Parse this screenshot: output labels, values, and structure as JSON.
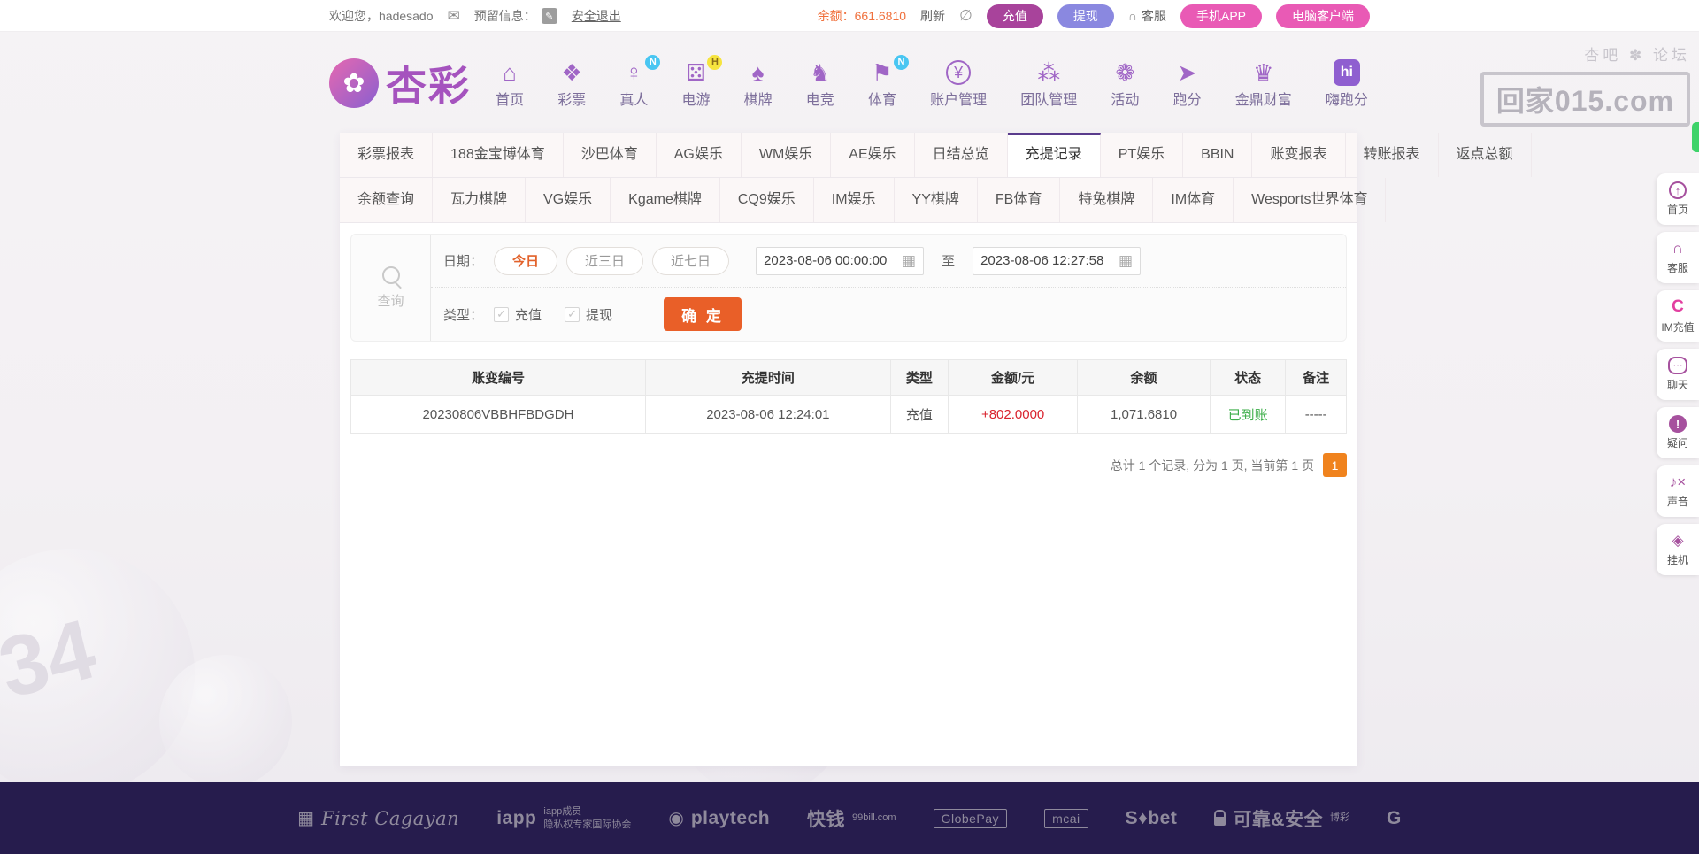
{
  "colors": {
    "accent_orange": "#e8612c",
    "balance_orange": "#f0703c",
    "recharge_purple": "#a8439b",
    "withdraw_indigo": "#8a88e0",
    "pink_button": "#e95ab5",
    "active_tab_border": "#5a3b8c",
    "amount_red": "#d9232e",
    "status_green": "#3dae4a",
    "pagination_orange": "#f0831e",
    "footer_bg": "#261c4d"
  },
  "topbar": {
    "welcome": "欢迎您，hadesado",
    "reserved_label": "预留信息：",
    "logout": "安全退出",
    "balance_label": "余额：",
    "balance_value": "661.6810",
    "refresh": "刷新",
    "recharge": "充值",
    "withdraw": "提现",
    "service": "客服",
    "mobile_app": "手机APP",
    "pc_client": "电脑客户端"
  },
  "header": {
    "logo_text": "杏彩",
    "nav": [
      {
        "label": "首页",
        "glyph": "⌂"
      },
      {
        "label": "彩票",
        "glyph": "❖"
      },
      {
        "label": "真人",
        "glyph": "♀",
        "badge": "N",
        "badge_class": "badge-cyan"
      },
      {
        "label": "电游",
        "glyph": "⚄",
        "badge": "H",
        "badge_class": "badge-yellow"
      },
      {
        "label": "棋牌",
        "glyph": "♠"
      },
      {
        "label": "电竞",
        "glyph": "♞"
      },
      {
        "label": "体育",
        "glyph": "⚑",
        "badge": "N",
        "badge_class": "badge-cyan"
      },
      {
        "label": "账户管理",
        "glyph": "¥",
        "icon_class": "circled"
      },
      {
        "label": "团队管理",
        "glyph": "⁂"
      },
      {
        "label": "活动",
        "glyph": "❁"
      },
      {
        "label": "跑分",
        "glyph": "➤"
      },
      {
        "label": "金鼎财富",
        "glyph": "♛"
      },
      {
        "label": "嗨跑分",
        "glyph": "hi",
        "icon_class": "hi-logo"
      }
    ]
  },
  "watermark": {
    "title": "杏吧 ✽ 论坛",
    "domain": "回家015.com"
  },
  "tabs": {
    "row1": [
      {
        "label": "彩票报表"
      },
      {
        "label": "188金宝博体育"
      },
      {
        "label": "沙巴体育"
      },
      {
        "label": "AG娱乐"
      },
      {
        "label": "WM娱乐"
      },
      {
        "label": "AE娱乐"
      },
      {
        "label": "日结总览"
      },
      {
        "label": "充提记录",
        "active": true
      },
      {
        "label": "PT娱乐"
      },
      {
        "label": "BBIN"
      },
      {
        "label": "账变报表"
      },
      {
        "label": "转账报表"
      },
      {
        "label": "返点总额"
      }
    ],
    "row2": [
      {
        "label": "余额查询"
      },
      {
        "label": "瓦力棋牌"
      },
      {
        "label": "VG娱乐"
      },
      {
        "label": "Kgame棋牌"
      },
      {
        "label": "CQ9娱乐"
      },
      {
        "label": "IM娱乐"
      },
      {
        "label": "YY棋牌"
      },
      {
        "label": "FB体育"
      },
      {
        "label": "特兔棋牌"
      },
      {
        "label": "IM体育"
      },
      {
        "label": "Wesports世界体育"
      }
    ]
  },
  "filter": {
    "query_label": "查询",
    "date_label": "日期：",
    "quick_buttons": [
      {
        "label": "今日",
        "active": true
      },
      {
        "label": "近三日"
      },
      {
        "label": "近七日"
      }
    ],
    "date_from": "2023-08-06 00:00:00",
    "to_label": "至",
    "date_to": "2023-08-06 12:27:58",
    "type_label": "类型：",
    "type_options": [
      {
        "label": "充值",
        "check": "✓"
      },
      {
        "label": "提现",
        "check": "✓"
      }
    ],
    "submit_label": "确 定"
  },
  "table": {
    "headers": [
      "账变编号",
      "充提时间",
      "类型",
      "金额/元",
      "余额",
      "状态",
      "备注"
    ],
    "rows": [
      {
        "id": "20230806VBBHFBDGDH",
        "time": "2023-08-06 12:24:01",
        "type": "充值",
        "amount": "+802.0000",
        "balance": "1,071.6810",
        "status": "已到账",
        "note": "-----"
      }
    ]
  },
  "pagination": {
    "summary": "总计 1 个记录, 分为 1 页, 当前第 1 页",
    "page": "1"
  },
  "sidebar": {
    "items": [
      {
        "label": "首页",
        "glyph": "↑",
        "icon_class": "circled",
        "icon_name": "back-top-icon"
      },
      {
        "label": "客服",
        "glyph": "∩",
        "icon_name": "service-headset-icon"
      },
      {
        "label": "IM充值",
        "glyph": "C",
        "icon_class": "pink-bold",
        "icon_name": "im-recharge-icon"
      },
      {
        "label": "聊天",
        "glyph": "⋯",
        "icon_class": "bubble",
        "icon_name": "chat-bubble-icon"
      },
      {
        "label": "疑问",
        "glyph": "!",
        "icon_class": "filled-circle",
        "icon_name": "question-icon"
      },
      {
        "label": "声音",
        "glyph": "♪×",
        "icon_name": "sound-mute-icon"
      },
      {
        "label": "挂机",
        "glyph": "◈",
        "icon_name": "idle-gem-icon"
      }
    ]
  },
  "footer": {
    "logos": [
      {
        "icon": "▦",
        "main": "First Cagayan",
        "sub": "",
        "main_class": "script"
      },
      {
        "icon": "",
        "main": "iapp",
        "sub": "iapp成员\n隐私权专家国际协会"
      },
      {
        "icon": "◉",
        "main": "playtech",
        "sub": "",
        "main_class": "lower"
      },
      {
        "icon": "",
        "main": "快钱",
        "sub": "99bill.com"
      },
      {
        "icon": "",
        "main": "GlobePay",
        "sub": "",
        "main_class": "box"
      },
      {
        "icon": "",
        "main": "mcai",
        "sub": "",
        "main_class": "box"
      },
      {
        "icon": "",
        "main": "S♦bet",
        "sub": ""
      },
      {
        "icon": "",
        "main": "可靠&安全",
        "sub": "博彩",
        "icon_class": "lock"
      },
      {
        "icon": "",
        "main": "G",
        "sub": ""
      }
    ]
  }
}
